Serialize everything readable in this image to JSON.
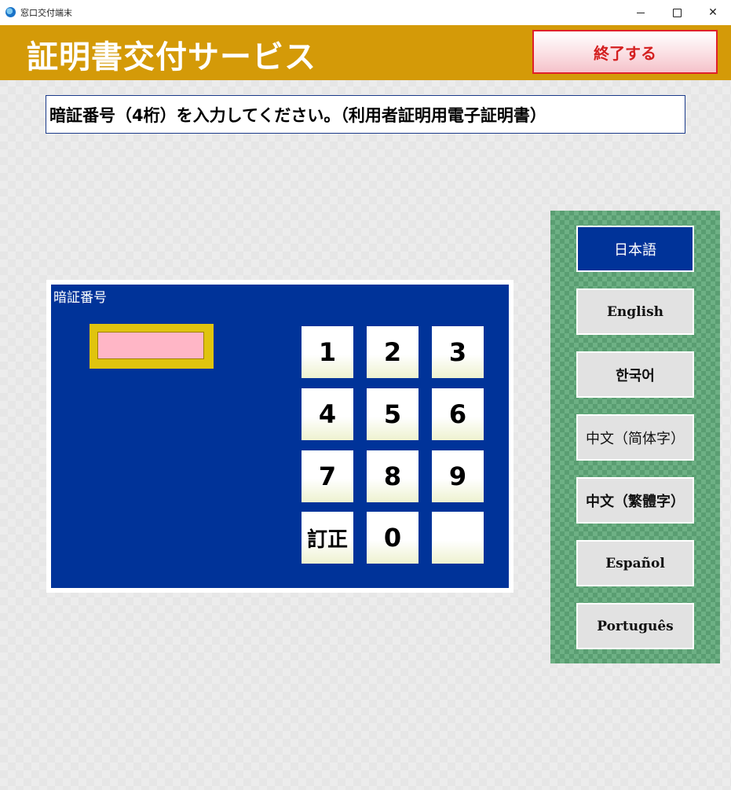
{
  "window": {
    "title": "窓口交付端末",
    "icon": "browser-icon"
  },
  "header": {
    "title": "証明書交付サービス",
    "exit_label": "終了する",
    "bg_color": "#d49a08"
  },
  "instruction": {
    "text": "暗証番号（4桁）を入力してください。（利用者証明用電子証明書）"
  },
  "pin_panel": {
    "label": "暗証番号",
    "value": "",
    "keys": [
      "1",
      "2",
      "3",
      "4",
      "5",
      "6",
      "7",
      "8",
      "9",
      "訂正",
      "0",
      ""
    ]
  },
  "languages": {
    "selected": "日本語",
    "items": [
      "日本語",
      "English",
      "한국어",
      "中文（简体字）",
      "中文（繁體字）",
      "Español",
      "Português"
    ]
  },
  "colors": {
    "accent_blue": "#003399",
    "exit_red": "#e0202a",
    "pin_bg": "#ffb6c6"
  }
}
